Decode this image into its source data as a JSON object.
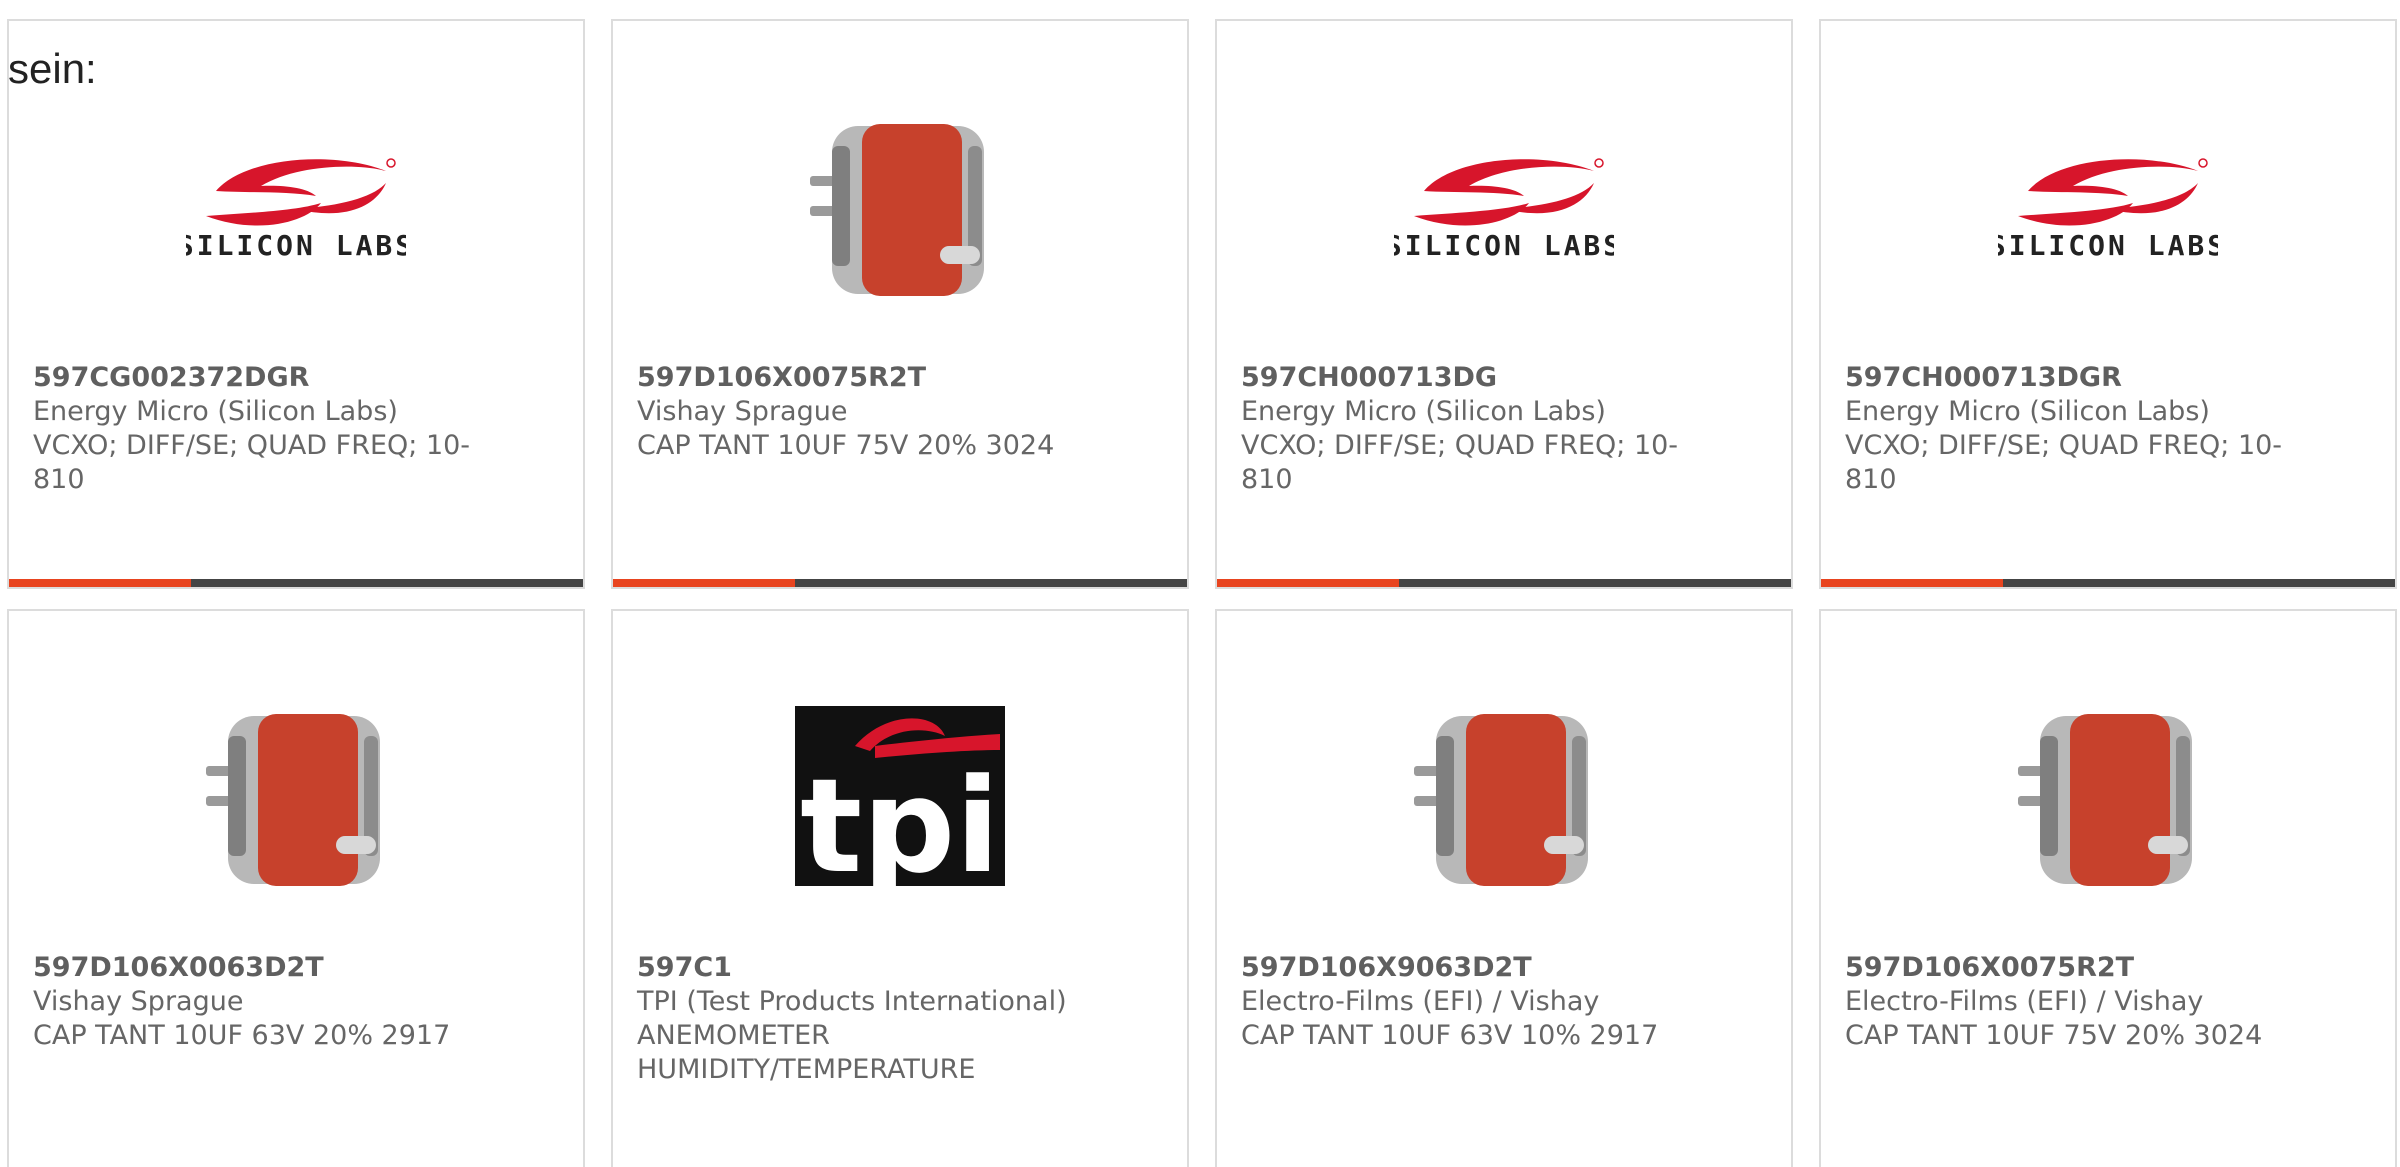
{
  "lead_text": "sein:",
  "colors": {
    "accent": "#e8441f",
    "bar": "#444444",
    "border": "#dcdcdc"
  },
  "cards": [
    {
      "part": "597CG002372DGR",
      "mfr": "Energy Micro (Silicon Labs)",
      "desc": "VCXO; DIFF/SE; QUAD FREQ; 10-810",
      "image": "silicon-labs-logo",
      "logo_text": "SILICON LABS"
    },
    {
      "part": "597D106X0075R2T",
      "mfr": "Vishay Sprague",
      "desc": "CAP TANT 10UF 75V 20% 3024",
      "image": "tantalum-capacitor"
    },
    {
      "part": "597CH000713DG",
      "mfr": "Energy Micro (Silicon Labs)",
      "desc": "VCXO; DIFF/SE; QUAD FREQ; 10-810",
      "image": "silicon-labs-logo",
      "logo_text": "SILICON LABS"
    },
    {
      "part": "597CH000713DGR",
      "mfr": "Energy Micro (Silicon Labs)",
      "desc": "VCXO; DIFF/SE; QUAD FREQ; 10-810",
      "image": "silicon-labs-logo",
      "logo_text": "SILICON LABS"
    },
    {
      "part": "597D106X0063D2T",
      "mfr": "Vishay Sprague",
      "desc": "CAP TANT 10UF 63V 20% 2917",
      "image": "tantalum-capacitor"
    },
    {
      "part": "597C1",
      "mfr": "TPI (Test Products International)",
      "desc": "ANEMOMETER HUMIDITY/TEMPERATURE",
      "image": "tpi-logo",
      "logo_text": "tpi"
    },
    {
      "part": "597D106X9063D2T",
      "mfr": "Electro-Films (EFI) / Vishay",
      "desc": "CAP TANT 10UF 63V 10% 2917",
      "image": "tantalum-capacitor"
    },
    {
      "part": "597D106X0075R2T",
      "mfr": "Electro-Films (EFI) / Vishay",
      "desc": "CAP TANT 10UF 75V 20% 3024",
      "image": "tantalum-capacitor"
    }
  ]
}
